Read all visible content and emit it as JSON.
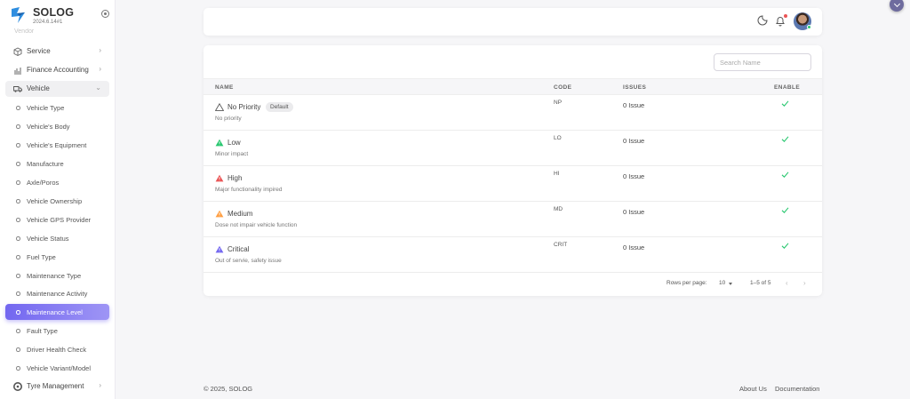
{
  "brand": {
    "name": "SOLOG",
    "version": "2024.6.14#1"
  },
  "sidebar": {
    "faded_item": "Vendor",
    "groups": [
      {
        "label": "Service",
        "chevron": "›"
      },
      {
        "label": "Finance Accounting",
        "chevron": "›"
      },
      {
        "label": "Vehicle",
        "chevron": "⌄"
      },
      {
        "label": "Tyre Management",
        "chevron": "›"
      }
    ],
    "vehicle_items": [
      "Vehicle Type",
      "Vehicle's Body",
      "Vehicle's Equipment",
      "Manufacture",
      "Axle/Poros",
      "Vehicle Ownership",
      "Vehicle GPS Provider",
      "Vehicle Status",
      "Fuel Type",
      "Maintenance Type",
      "Maintenance Activity",
      "Maintenance Level",
      "Fault Type",
      "Driver Health Check",
      "Vehicle Variant/Model"
    ],
    "active_item": "Maintenance Level"
  },
  "search": {
    "placeholder": "Search Name",
    "value": ""
  },
  "table": {
    "headers": {
      "name": "NAME",
      "code": "CODE",
      "issues": "ISSUES",
      "enable": "ENABLE"
    },
    "rows": [
      {
        "name": "No Priority",
        "badge": "Default",
        "desc": "No priority",
        "code": "NP",
        "issues": "0 Issue",
        "icon_color": "#ffffff",
        "icon": "warning-outline-icon"
      },
      {
        "name": "Low",
        "badge": "",
        "desc": "Minor impact",
        "code": "LO",
        "issues": "0 Issue",
        "icon_color": "#28c76f",
        "icon": "warning-green-icon"
      },
      {
        "name": "High",
        "badge": "",
        "desc": "Major functionality impired",
        "code": "HI",
        "issues": "0 Issue",
        "icon_color": "#ea5455",
        "icon": "warning-red-icon"
      },
      {
        "name": "Medium",
        "badge": "",
        "desc": "Dose not impair vehicle function",
        "code": "MD",
        "issues": "0 Issue",
        "icon_color": "#ff9f43",
        "icon": "warning-orange-icon"
      },
      {
        "name": "Critical",
        "badge": "",
        "desc": "Out of servie, safety issue",
        "code": "CRIT",
        "issues": "0 Issue",
        "icon_color": "#7367f0",
        "icon": "warning-purple-icon"
      }
    ]
  },
  "pagination": {
    "rows_label": "Rows per page:",
    "rows_value": "10",
    "range": "1–5 of 5"
  },
  "footer": {
    "copyright": "© 2025, SOLOG",
    "about": "About Us",
    "docs": "Documentation"
  },
  "colors": {
    "accent": "#7367f0",
    "check": "#28c76f"
  }
}
